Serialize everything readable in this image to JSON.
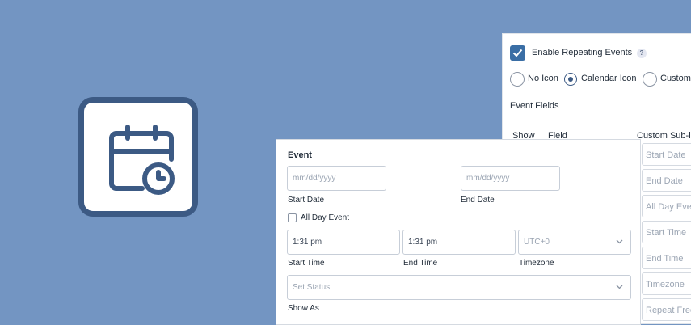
{
  "app_icon": {
    "name": "calendar-clock-icon"
  },
  "settings": {
    "enable_label": "Enable Repeating Events",
    "help": "?",
    "radios": [
      {
        "label": "No Icon",
        "selected": false
      },
      {
        "label": "Calendar Icon",
        "selected": true
      },
      {
        "label": "Custom",
        "selected": false
      }
    ],
    "fields_heading": "Event Fields",
    "columns": {
      "show": "Show",
      "field": "Field",
      "custom_sub": "Custom Sub-l"
    },
    "sub_fields": [
      "Start Date",
      "End Date",
      "All Day Even",
      "Start Time",
      "End Time",
      "Timezone",
      "Repeat Frec"
    ]
  },
  "event": {
    "title": "Event",
    "start_date": {
      "placeholder": "mm/dd/yyyy",
      "label": "Start Date"
    },
    "end_date": {
      "placeholder": "mm/dd/yyyy",
      "label": "End Date"
    },
    "all_day_label": "All Day Event",
    "start_time": {
      "value": "1:31 pm",
      "label": "Start Time"
    },
    "end_time": {
      "value": "1:31 pm",
      "label": "End Time"
    },
    "timezone": {
      "value": "UTC+0",
      "label": "Timezone"
    },
    "status": {
      "placeholder": "Set Status",
      "label": "Show As"
    }
  },
  "colors": {
    "background": "#7395c2",
    "accent": "#3c5a84",
    "checkbox": "#3a6ea5"
  }
}
